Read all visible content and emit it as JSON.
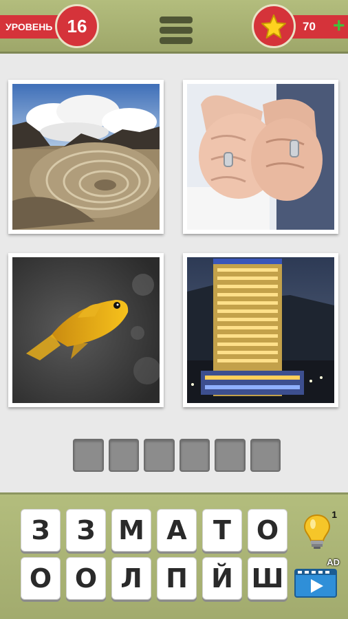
{
  "header": {
    "level_label": "УРОВЕНЬ",
    "level_number": "16",
    "coins": "70",
    "add_coins_symbol": "+"
  },
  "pictures": [
    {
      "subject": "open-pit mine under cloudy sky"
    },
    {
      "subject": "two fists with wedding rings"
    },
    {
      "subject": "yellow fish"
    },
    {
      "subject": "lit hotel tower at night"
    }
  ],
  "answer": {
    "slot_count": 6,
    "filled": [
      "",
      "",
      "",
      "",
      "",
      ""
    ]
  },
  "keyboard": {
    "row1": [
      "З",
      "З",
      "М",
      "А",
      "Т",
      "О"
    ],
    "row2": [
      "О",
      "О",
      "Л",
      "П",
      "Й",
      "Ш"
    ]
  },
  "hint": {
    "count": "1",
    "icon": "lightbulb-icon"
  },
  "ad": {
    "label": "AD",
    "icon": "video-play-icon"
  },
  "colors": {
    "bar_green": "#b3bd7d",
    "ribbon_red": "#d5333a",
    "slot_gray": "#8c8c8c"
  }
}
